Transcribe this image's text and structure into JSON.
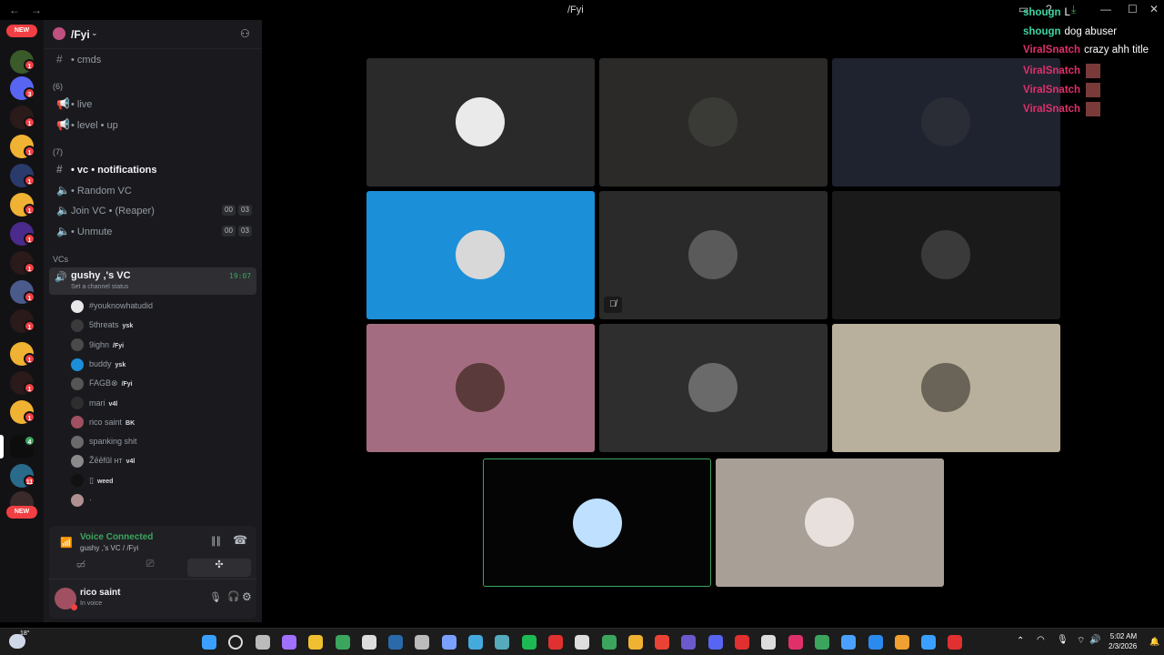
{
  "window": {
    "title": "/Fyi",
    "back": "←",
    "forward": "→",
    "minimize": "—",
    "maximize": "☐",
    "close": "✕"
  },
  "rail": {
    "new_label": "NEW",
    "new_label_bottom": "NEW"
  },
  "server": {
    "name": "/Fyi"
  },
  "channels": {
    "cmds": "• cmds",
    "cat6": "(6)",
    "live": "• live",
    "levelup": "• level • up",
    "cat7": "(7)",
    "vcnotif": "• vc • notifications",
    "random": "• Random VC",
    "joinvc": "Join VC • (Reaper)",
    "joinvc_count_a": "00",
    "joinvc_count_b": "03",
    "unmute": "• Unmute",
    "unmute_count_a": "00",
    "unmute_count_b": "03",
    "catvcs": "VCs",
    "activevc": "gushy ,'s VC",
    "activevc_time": "19:07",
    "activevc_status": "Set a channel status"
  },
  "members": [
    {
      "name": "#youknowhatudid",
      "tag": "",
      "color": "#e8e8e8"
    },
    {
      "name": "5threats",
      "tag": "ysk",
      "color": "#3a3a3a"
    },
    {
      "name": "9ighn",
      "tag": "/Fyi",
      "color": "#4a4a4a"
    },
    {
      "name": "buddy",
      "tag": "ysk",
      "color": "#1b8fd8"
    },
    {
      "name": "FAGB⊗",
      "tag": "/Fyi",
      "color": "#555"
    },
    {
      "name": "mari",
      "tag": "v4l",
      "color": "#2e2e2e"
    },
    {
      "name": "rico saint",
      "tag": "BK",
      "color": "#a05060"
    },
    {
      "name": "spanking shit",
      "tag": "",
      "color": "#6a6a6a"
    },
    {
      "name": "Žēēfŭl ʜᴛ",
      "tag": "v4l",
      "color": "#8a8a8a"
    },
    {
      "name": "▯",
      "tag": "weed",
      "color": "#111"
    },
    {
      "name": "·",
      "tag": "",
      "color": "#b09090"
    }
  ],
  "voice": {
    "status": "Voice Connected",
    "location": "gushy ,'s VC / /Fyi"
  },
  "user": {
    "name": "rico saint",
    "status": "In voice"
  },
  "chat": [
    {
      "user": "shougn",
      "msg": "L",
      "color": "#3dd6a0"
    },
    {
      "user": "shougn",
      "msg": "dog abuser",
      "color": "#3dd6a0"
    },
    {
      "user": "ViralSnatch",
      "msg": "crazy ahh title",
      "color": "#e0306a"
    },
    {
      "user": "ViralSnatch",
      "msg": "",
      "color": "#e0306a"
    },
    {
      "user": "ViralSnatch",
      "msg": "",
      "color": "#e0306a"
    },
    {
      "user": "ViralSnatch",
      "msg": "",
      "color": "#e0306a"
    }
  ],
  "tiles": [
    {
      "bg": "#2a2a2a",
      "av": "#eaeaea"
    },
    {
      "bg": "#2b2a28",
      "av": "#3a3a36"
    },
    {
      "bg": "#1f2330",
      "av": "#2a2c36"
    },
    {
      "bg": "#1c8fd9",
      "av": "#d8d8d8"
    },
    {
      "bg": "#2a2a2a",
      "av": "#5a5a5a"
    },
    {
      "bg": "#1a1a1a",
      "av": "#3a3a3a"
    },
    {
      "bg": "#a46c80",
      "av": "#5a3a3a"
    },
    {
      "bg": "#2e2e2e",
      "av": "#6a6a6a"
    },
    {
      "bg": "#b8b09c",
      "av": "#6a6458"
    },
    {
      "bg": "#050505",
      "av": "#bfe0ff"
    },
    {
      "bg": "#a8a096",
      "av": "#e8e0dc"
    }
  ],
  "taskbar": {
    "weather": "18°",
    "time": "5:02 AM",
    "date": "2/3/2026"
  }
}
